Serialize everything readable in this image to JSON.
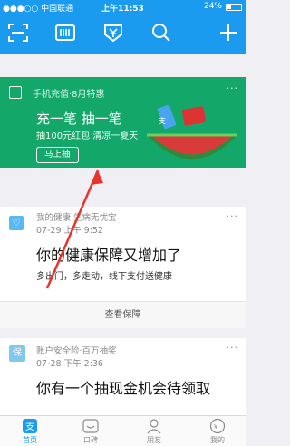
{
  "status_bar": {
    "carrier": "●●●○○ 中国联通 ",
    "time": "上午11:53",
    "battery": "24%"
  },
  "header": {
    "icons": [
      "scan-icon",
      "barcode-icon",
      "wallet-icon",
      "search-icon",
      "plus-icon"
    ]
  },
  "promo_card": {
    "source": "手机充值·8月特惠",
    "title": "充一笔 抽一笔",
    "subtitle": "抽100元红包 清凉一夏天",
    "cta": "马上抽",
    "more": "···"
  },
  "health_card": {
    "source": "我的健康·生病无忧宝",
    "date": "07-29 上午 9:52",
    "title": "你的健康保障又增加了",
    "desc": "多出门，多走动，线下支付送健康",
    "view": "查看保障",
    "more": "···"
  },
  "insurance_card": {
    "badge": "保",
    "source": "账户安全险·百万抽奖",
    "date": "07-28 下午 2:36",
    "title": "你有一个抽现金机会待领取",
    "more": "···"
  },
  "tab_bar": {
    "tabs": [
      {
        "label": "首页"
      },
      {
        "label": "口碑"
      },
      {
        "label": "朋友"
      },
      {
        "label": "我的"
      }
    ],
    "accent": "#1a9bef"
  }
}
